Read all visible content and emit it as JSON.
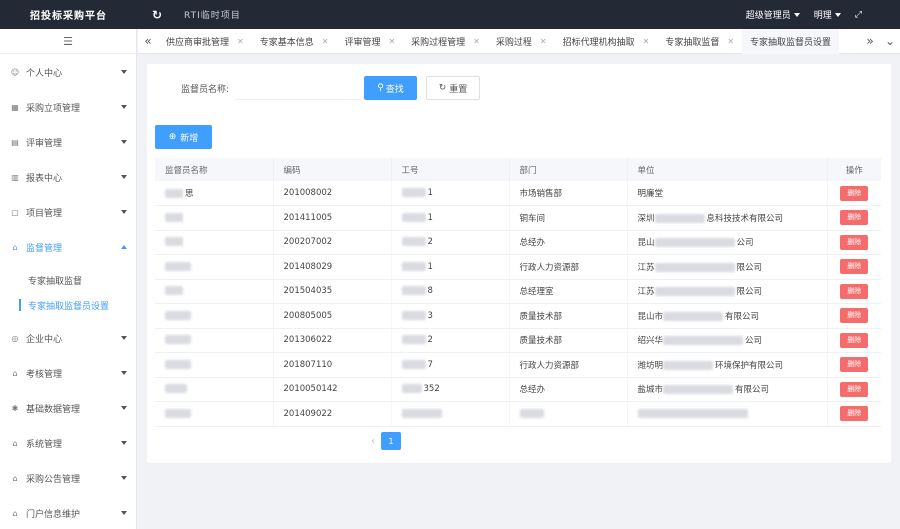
{
  "app": {
    "title": "招投标采购平台",
    "project_label": "RTI临时项目",
    "user_role": "超级管理员",
    "user_name": "明理"
  },
  "sidebar": {
    "items": [
      {
        "label": "个人中心",
        "icon": "user-icon"
      },
      {
        "label": "采购立项管理",
        "icon": "project-icon"
      },
      {
        "label": "评审管理",
        "icon": "review-icon"
      },
      {
        "label": "报表中心",
        "icon": "report-icon"
      },
      {
        "label": "项目管理",
        "icon": "file-icon"
      },
      {
        "label": "监督管理",
        "icon": "home-icon"
      },
      {
        "label": "企业中心",
        "icon": "enterprise-icon"
      },
      {
        "label": "考核管理",
        "icon": "assess-icon"
      },
      {
        "label": "基础数据管理",
        "icon": "data-icon"
      },
      {
        "label": "系统管理",
        "icon": "system-icon"
      },
      {
        "label": "采购公告管理",
        "icon": "notice-icon"
      },
      {
        "label": "门户信息维护",
        "icon": "portal-icon"
      }
    ],
    "submenu": [
      {
        "label": "专家抽取监督"
      },
      {
        "label": "专家抽取监督员设置"
      }
    ]
  },
  "tabs": [
    {
      "label": "供应商审批管理"
    },
    {
      "label": "专家基本信息"
    },
    {
      "label": "评审管理"
    },
    {
      "label": "采购过程管理"
    },
    {
      "label": "采购过程"
    },
    {
      "label": "招标代理机构抽取"
    },
    {
      "label": "专家抽取监督"
    },
    {
      "label": "专家抽取监督员设置"
    }
  ],
  "search": {
    "label": "监督员名称:",
    "value": "",
    "placeholder": "",
    "search_button": "查找",
    "reset_button": "重置"
  },
  "add_button": "新增",
  "table": {
    "headers": [
      "监督员名称",
      "编码",
      "工号",
      "部门",
      "单位",
      "操作"
    ],
    "rows": [
      {
        "name": "思",
        "code": "201008002",
        "job": "1",
        "dept": "市场销售部",
        "unit": "明廉",
        "unit_tail": "堂"
      },
      {
        "name": "",
        "code": "201411005",
        "job": "1",
        "dept": "铜车间",
        "unit": "深圳",
        "unit_tail": "息科技技术有限公司"
      },
      {
        "name": "",
        "code": "200207002",
        "job": "2",
        "dept": "总经办",
        "unit": "昆山",
        "unit_tail": "公司"
      },
      {
        "name": "",
        "code": "201408029",
        "job": "1",
        "dept": "行政人力资源部",
        "unit": "江苏",
        "unit_tail": "限公司"
      },
      {
        "name": "",
        "code": "201504035",
        "job": "8",
        "dept": "总经理室",
        "unit": "江苏",
        "unit_tail": "限公司"
      },
      {
        "name": "",
        "code": "200805005",
        "job": "3",
        "dept": "质量技术部",
        "unit": "昆山市",
        "unit_tail": "有限公司"
      },
      {
        "name": "",
        "code": "201306022",
        "job": "2",
        "dept": "质量技术部",
        "unit": "绍兴华",
        "unit_tail": "公司"
      },
      {
        "name": "",
        "code": "201807110",
        "job": "7",
        "dept": "行政人力资源部",
        "unit": "潍坊明",
        "unit_tail": "环境保护有限公司"
      },
      {
        "name": "",
        "code": "2010050142",
        "job": "352",
        "dept": "总经办",
        "unit": "盐城市",
        "unit_tail": "有限公司"
      },
      {
        "name": "",
        "code": "201409022",
        "job": "",
        "dept": "",
        "unit": "",
        "unit_tail": ""
      }
    ],
    "delete_label": "删除"
  },
  "pagination": {
    "current_page": "1",
    "prev": "‹"
  },
  "colors": {
    "header_bg": "#232a36",
    "primary": "#409eff",
    "danger": "#f56c6c"
  }
}
